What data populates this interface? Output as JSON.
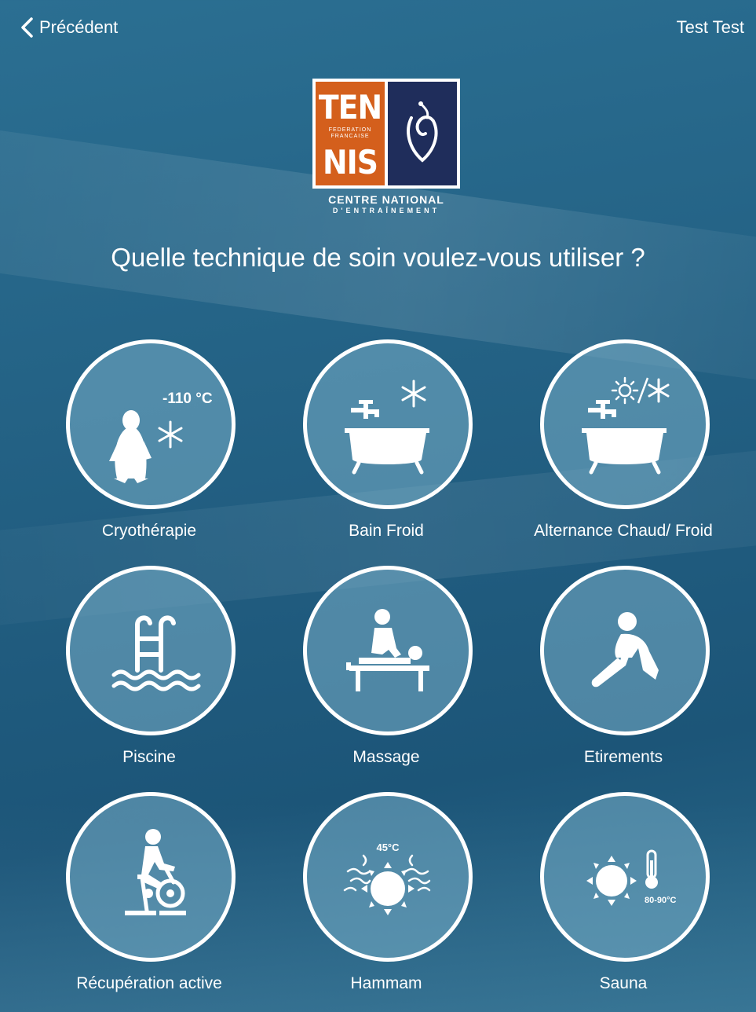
{
  "nav": {
    "back_label": "Précédent",
    "user_name": "Test Test"
  },
  "logo": {
    "line1": "TEN",
    "line2": "NIS",
    "federation": "FEDERATION FRANCAISE",
    "caption1": "CENTRE NATIONAL",
    "caption2": "D'ENTRAÎNEMENT"
  },
  "question": "Quelle technique de soin voulez-vous utiliser ?",
  "options": [
    {
      "label": "Cryothérapie",
      "icon": "penguin-snowflake-icon",
      "badge": "-110 °C"
    },
    {
      "label": "Bain Froid",
      "icon": "bathtub-snowflake-icon"
    },
    {
      "label": "Alternance Chaud/ Froid",
      "icon": "bathtub-sun-snowflake-icon"
    },
    {
      "label": "Piscine",
      "icon": "pool-ladder-icon"
    },
    {
      "label": "Massage",
      "icon": "massage-table-icon"
    },
    {
      "label": "Etirements",
      "icon": "stretching-person-icon"
    },
    {
      "label": "Récupération active",
      "icon": "exercise-bike-icon"
    },
    {
      "label": "Hammam",
      "icon": "steam-sun-icon",
      "badge": "45°C"
    },
    {
      "label": "Sauna",
      "icon": "sun-thermometer-icon",
      "badge": "80-90°C"
    }
  ],
  "colors": {
    "background": "#225f82",
    "circle_fill": "#78afc8",
    "logo_orange": "#d45f1c",
    "logo_navy": "#1f2d5b"
  }
}
